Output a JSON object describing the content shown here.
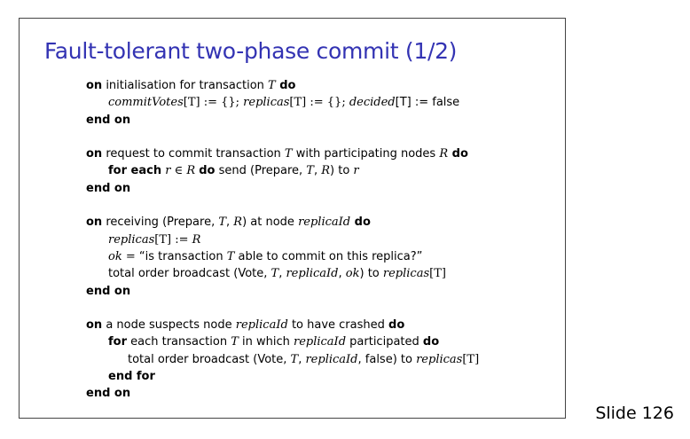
{
  "title": "Fault-tolerant two-phase commit (1/2)",
  "slide_label": "Slide 126",
  "colors": {
    "title": "#3333b3",
    "text": "#000000",
    "frame_border": "#444444"
  },
  "blocks": [
    {
      "lines": [
        [
          "on",
          " initialisation for transaction ",
          "T",
          " do"
        ],
        [
          "commitVotes",
          "[T] := {}; ",
          "replicas",
          "[T] := {}; ",
          "decided",
          "[T] := false"
        ],
        [
          "end on"
        ]
      ]
    },
    {
      "lines": [
        [
          "on",
          " request to commit transaction ",
          "T",
          " with participating nodes ",
          "R",
          " do"
        ],
        [
          "for each",
          " r ∈ R ",
          "do",
          " send (Prepare, ",
          "T",
          ", ",
          "R",
          ") to ",
          "r"
        ],
        [
          "end on"
        ]
      ]
    },
    {
      "lines": [
        [
          "on",
          " receiving (Prepare, ",
          "T",
          ", ",
          "R",
          ") at node ",
          "replicaId",
          " do"
        ],
        [
          "replicas",
          "[T] := ",
          "R"
        ],
        [
          "ok",
          " = ",
          "“is transaction ",
          "T",
          " able to commit on this replica?”"
        ],
        [
          "total order broadcast (Vote, ",
          "T",
          ", ",
          "replicaId",
          ", ",
          "ok",
          ") to ",
          "replicas",
          "[T]"
        ],
        [
          "end on"
        ]
      ]
    },
    {
      "lines": [
        [
          "on",
          " a node suspects node ",
          "replicaId",
          " to have crashed ",
          "do"
        ],
        [
          "for",
          " each transaction ",
          "T",
          " in which ",
          "replicaId",
          " participated ",
          "do"
        ],
        [
          "total order broadcast (Vote, ",
          "T",
          ", ",
          "replicaId",
          ", false) to ",
          "replicas",
          "[T]"
        ],
        [
          "end for"
        ],
        [
          "end on"
        ]
      ]
    }
  ]
}
